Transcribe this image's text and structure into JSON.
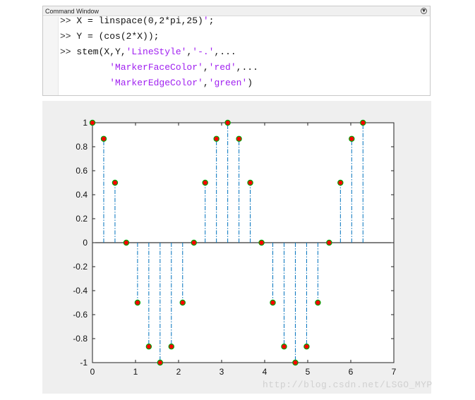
{
  "command_window": {
    "title": "Command Window",
    "menu_icon": "chevron-down-circle-icon",
    "lines": [
      {
        "prompt": ">>",
        "parts": [
          {
            "t": "X = linspace(0,2*pi,25)",
            "s": false
          },
          {
            "t": "'",
            "s": true
          },
          {
            "t": ";",
            "s": false
          }
        ]
      },
      {
        "prompt": ">>",
        "parts": [
          {
            "t": "Y = (cos(2*X));",
            "s": false
          }
        ]
      },
      {
        "prompt": ">>",
        "parts": [
          {
            "t": "stem(X,Y,",
            "s": false
          },
          {
            "t": "'LineStyle'",
            "s": true
          },
          {
            "t": ",",
            "s": false
          },
          {
            "t": "'-.'",
            "s": true
          },
          {
            "t": ",...",
            "s": false
          }
        ]
      },
      {
        "prompt": "",
        "parts": [
          {
            "t": "      ",
            "s": false
          },
          {
            "t": "'MarkerFaceColor'",
            "s": true
          },
          {
            "t": ",",
            "s": false
          },
          {
            "t": "'red'",
            "s": true
          },
          {
            "t": ",...",
            "s": false
          }
        ]
      },
      {
        "prompt": "",
        "parts": [
          {
            "t": "      ",
            "s": false
          },
          {
            "t": "'MarkerEdgeColor'",
            "s": true
          },
          {
            "t": ",",
            "s": false
          },
          {
            "t": "'green'",
            "s": true
          },
          {
            "t": ")",
            "s": false
          }
        ]
      }
    ]
  },
  "chart_data": {
    "type": "stem",
    "x": [
      0,
      0.2618,
      0.5236,
      0.7854,
      1.0472,
      1.309,
      1.5708,
      1.8326,
      2.0944,
      2.3562,
      2.618,
      2.8798,
      3.1416,
      3.4034,
      3.6652,
      3.927,
      4.1888,
      4.4506,
      4.7124,
      4.9742,
      5.236,
      5.4978,
      5.7596,
      6.0214,
      6.2832
    ],
    "y": [
      1,
      0.866,
      0.5,
      0,
      -0.5,
      -0.866,
      -1,
      -0.866,
      -0.5,
      0,
      0.5,
      0.866,
      1,
      0.866,
      0.5,
      0,
      -0.5,
      -0.866,
      -1,
      -0.866,
      -0.5,
      0,
      0.5,
      0.866,
      1
    ],
    "xlim": [
      0,
      7
    ],
    "ylim": [
      -1,
      1
    ],
    "xticks": [
      0,
      1,
      2,
      3,
      4,
      5,
      6,
      7
    ],
    "yticks": [
      1,
      0.8,
      0.6,
      0.4,
      0.2,
      0,
      -0.2,
      -0.4,
      -0.6,
      -0.8,
      -1
    ],
    "xtick_labels": [
      "0",
      "1",
      "2",
      "3",
      "4",
      "5",
      "6",
      "7"
    ],
    "ytick_labels": [
      "1",
      "0.8",
      "0.6",
      "0.4",
      "0.2",
      "0",
      "-0.2",
      "-0.4",
      "-0.6",
      "-0.8",
      "-1"
    ],
    "line_style": "-.",
    "line_color": "#0072bd",
    "marker_face_color": "#ff0000",
    "marker_edge_color": "#00a000",
    "baseline": 0,
    "grid": false,
    "legend": false
  },
  "watermark": "http://blog.csdn.net/LSGO_MYP"
}
